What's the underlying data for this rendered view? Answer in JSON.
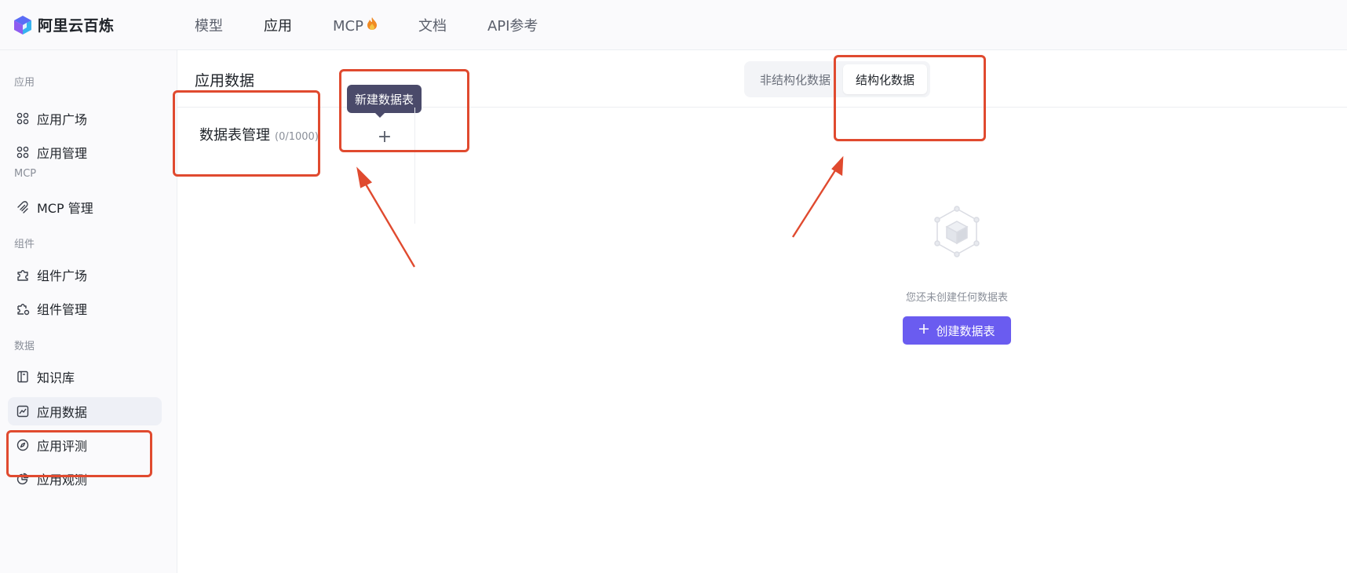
{
  "app": {
    "logo_text": "阿里云百炼"
  },
  "nav": [
    {
      "label": "模型",
      "active": false
    },
    {
      "label": "应用",
      "active": true
    },
    {
      "label": "MCP",
      "active": false,
      "badge_icon": "flame-icon"
    },
    {
      "label": "文档",
      "active": false
    },
    {
      "label": "API参考",
      "active": false
    }
  ],
  "sidebar": {
    "groups": {
      "app": "应用",
      "mcp": "MCP",
      "component": "组件",
      "data": "数据"
    },
    "items": [
      {
        "label": "应用广场",
        "icon": "app-grid-icon"
      },
      {
        "label": "应用管理",
        "icon": "app-grid-icon"
      },
      {
        "label": "MCP 管理",
        "icon": "mcp-icon"
      },
      {
        "label": "组件广场",
        "icon": "puzzle-icon"
      },
      {
        "label": "组件管理",
        "icon": "puzzle-gear-icon"
      },
      {
        "label": "知识库",
        "icon": "book-icon"
      },
      {
        "label": "应用数据",
        "icon": "chart-line-icon",
        "active": true
      },
      {
        "label": "应用评测",
        "icon": "compass-icon"
      },
      {
        "label": "应用观测",
        "icon": "pie-icon"
      }
    ]
  },
  "main": {
    "title": "应用数据",
    "tabs": [
      {
        "label": "非结构化数据",
        "active": false
      },
      {
        "label": "结构化数据",
        "active": true
      }
    ],
    "tables": {
      "heading": "数据表管理",
      "count": "(0/1000)",
      "add_symbol": "+",
      "add_tooltip": "新建数据表"
    },
    "empty": {
      "text": "您还未创建任何数据表",
      "button_label": "创建数据表"
    }
  },
  "colors": {
    "accent": "#6a5cf0",
    "annotation": "#e04a2f",
    "tooltip_bg": "#4a4a6a"
  }
}
